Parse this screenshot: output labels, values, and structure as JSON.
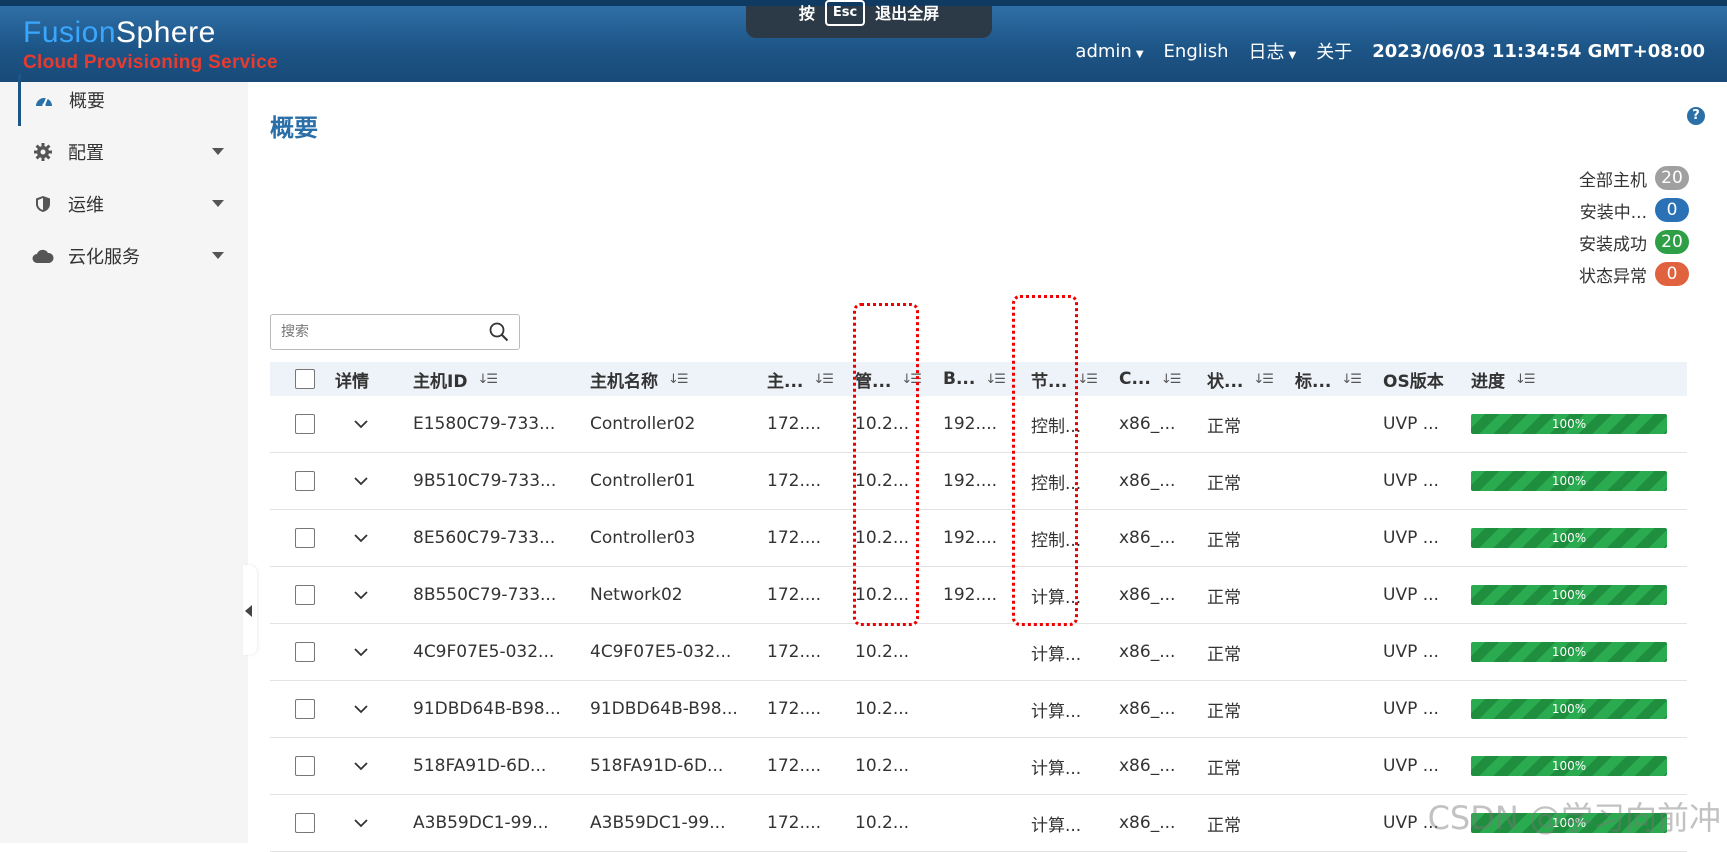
{
  "header": {
    "logo_line1_a": "Fusion",
    "logo_line1_b": "Sphere",
    "logo_line2": "Cloud Provisioning Service",
    "esc_prefix": "按",
    "esc_key": "Esc",
    "esc_suffix": "退出全屏",
    "nav": {
      "user": "admin",
      "language": "English",
      "log": "日志",
      "about": "关于",
      "datetime": "2023/06/03 11:34:54 GMT+08:00"
    }
  },
  "sidebar": {
    "items": [
      {
        "label": "概要",
        "icon": "dashboard-icon"
      },
      {
        "label": "配置",
        "icon": "gear-icon"
      },
      {
        "label": "运维",
        "icon": "shield-icon"
      },
      {
        "label": "云化服务",
        "icon": "cloud-icon"
      }
    ]
  },
  "main": {
    "title": "概要",
    "help": "?",
    "stats": [
      {
        "label": "全部主机",
        "count": "20",
        "color": "#a0a0a0"
      },
      {
        "label": "安装中...",
        "count": "0",
        "color": "#2a72b5"
      },
      {
        "label": "安装成功",
        "count": "20",
        "color": "#2e9e47"
      },
      {
        "label": "状态异常",
        "count": "0",
        "color": "#e0623e"
      }
    ],
    "search_placeholder": "搜索"
  },
  "table": {
    "headers": [
      "详情",
      "主机ID",
      "主机名称",
      "主...",
      "管...",
      "B...",
      "节...",
      "C...",
      "状...",
      "标...",
      "OS版本",
      "进度"
    ],
    "rows": [
      [
        "E1580C79-733...",
        "Controller02",
        "172....",
        "10.2...",
        "192....",
        "控制...",
        "x86_...",
        "正常",
        "",
        "UVP ...",
        "100%"
      ],
      [
        "9B510C79-733...",
        "Controller01",
        "172....",
        "10.2...",
        "192....",
        "控制...",
        "x86_...",
        "正常",
        "",
        "UVP ...",
        "100%"
      ],
      [
        "8E560C79-733...",
        "Controller03",
        "172....",
        "10.2...",
        "192....",
        "控制...",
        "x86_...",
        "正常",
        "",
        "UVP ...",
        "100%"
      ],
      [
        "8B550C79-733...",
        "Network02",
        "172....",
        "10.2...",
        "192....",
        "计算...",
        "x86_...",
        "正常",
        "",
        "UVP ...",
        "100%"
      ],
      [
        "4C9F07E5-032...",
        "4C9F07E5-032...",
        "172....",
        "10.2...",
        "",
        "计算...",
        "x86_...",
        "正常",
        "",
        "UVP ...",
        "100%"
      ],
      [
        "91DBD64B-B98...",
        "91DBD64B-B98...",
        "172....",
        "10.2...",
        "",
        "计算...",
        "x86_...",
        "正常",
        "",
        "UVP ...",
        "100%"
      ],
      [
        "518FA91D-6D...",
        "518FA91D-6D...",
        "172....",
        "10.2...",
        "",
        "计算...",
        "x86_...",
        "正常",
        "",
        "UVP ...",
        "100%"
      ],
      [
        "A3B59DC1-99...",
        "A3B59DC1-99...",
        "172....",
        "10.2...",
        "",
        "计算...",
        "x86_...",
        "正常",
        "",
        "UVP ...",
        "100%"
      ]
    ]
  },
  "watermark": "CSDN @学习向前冲"
}
